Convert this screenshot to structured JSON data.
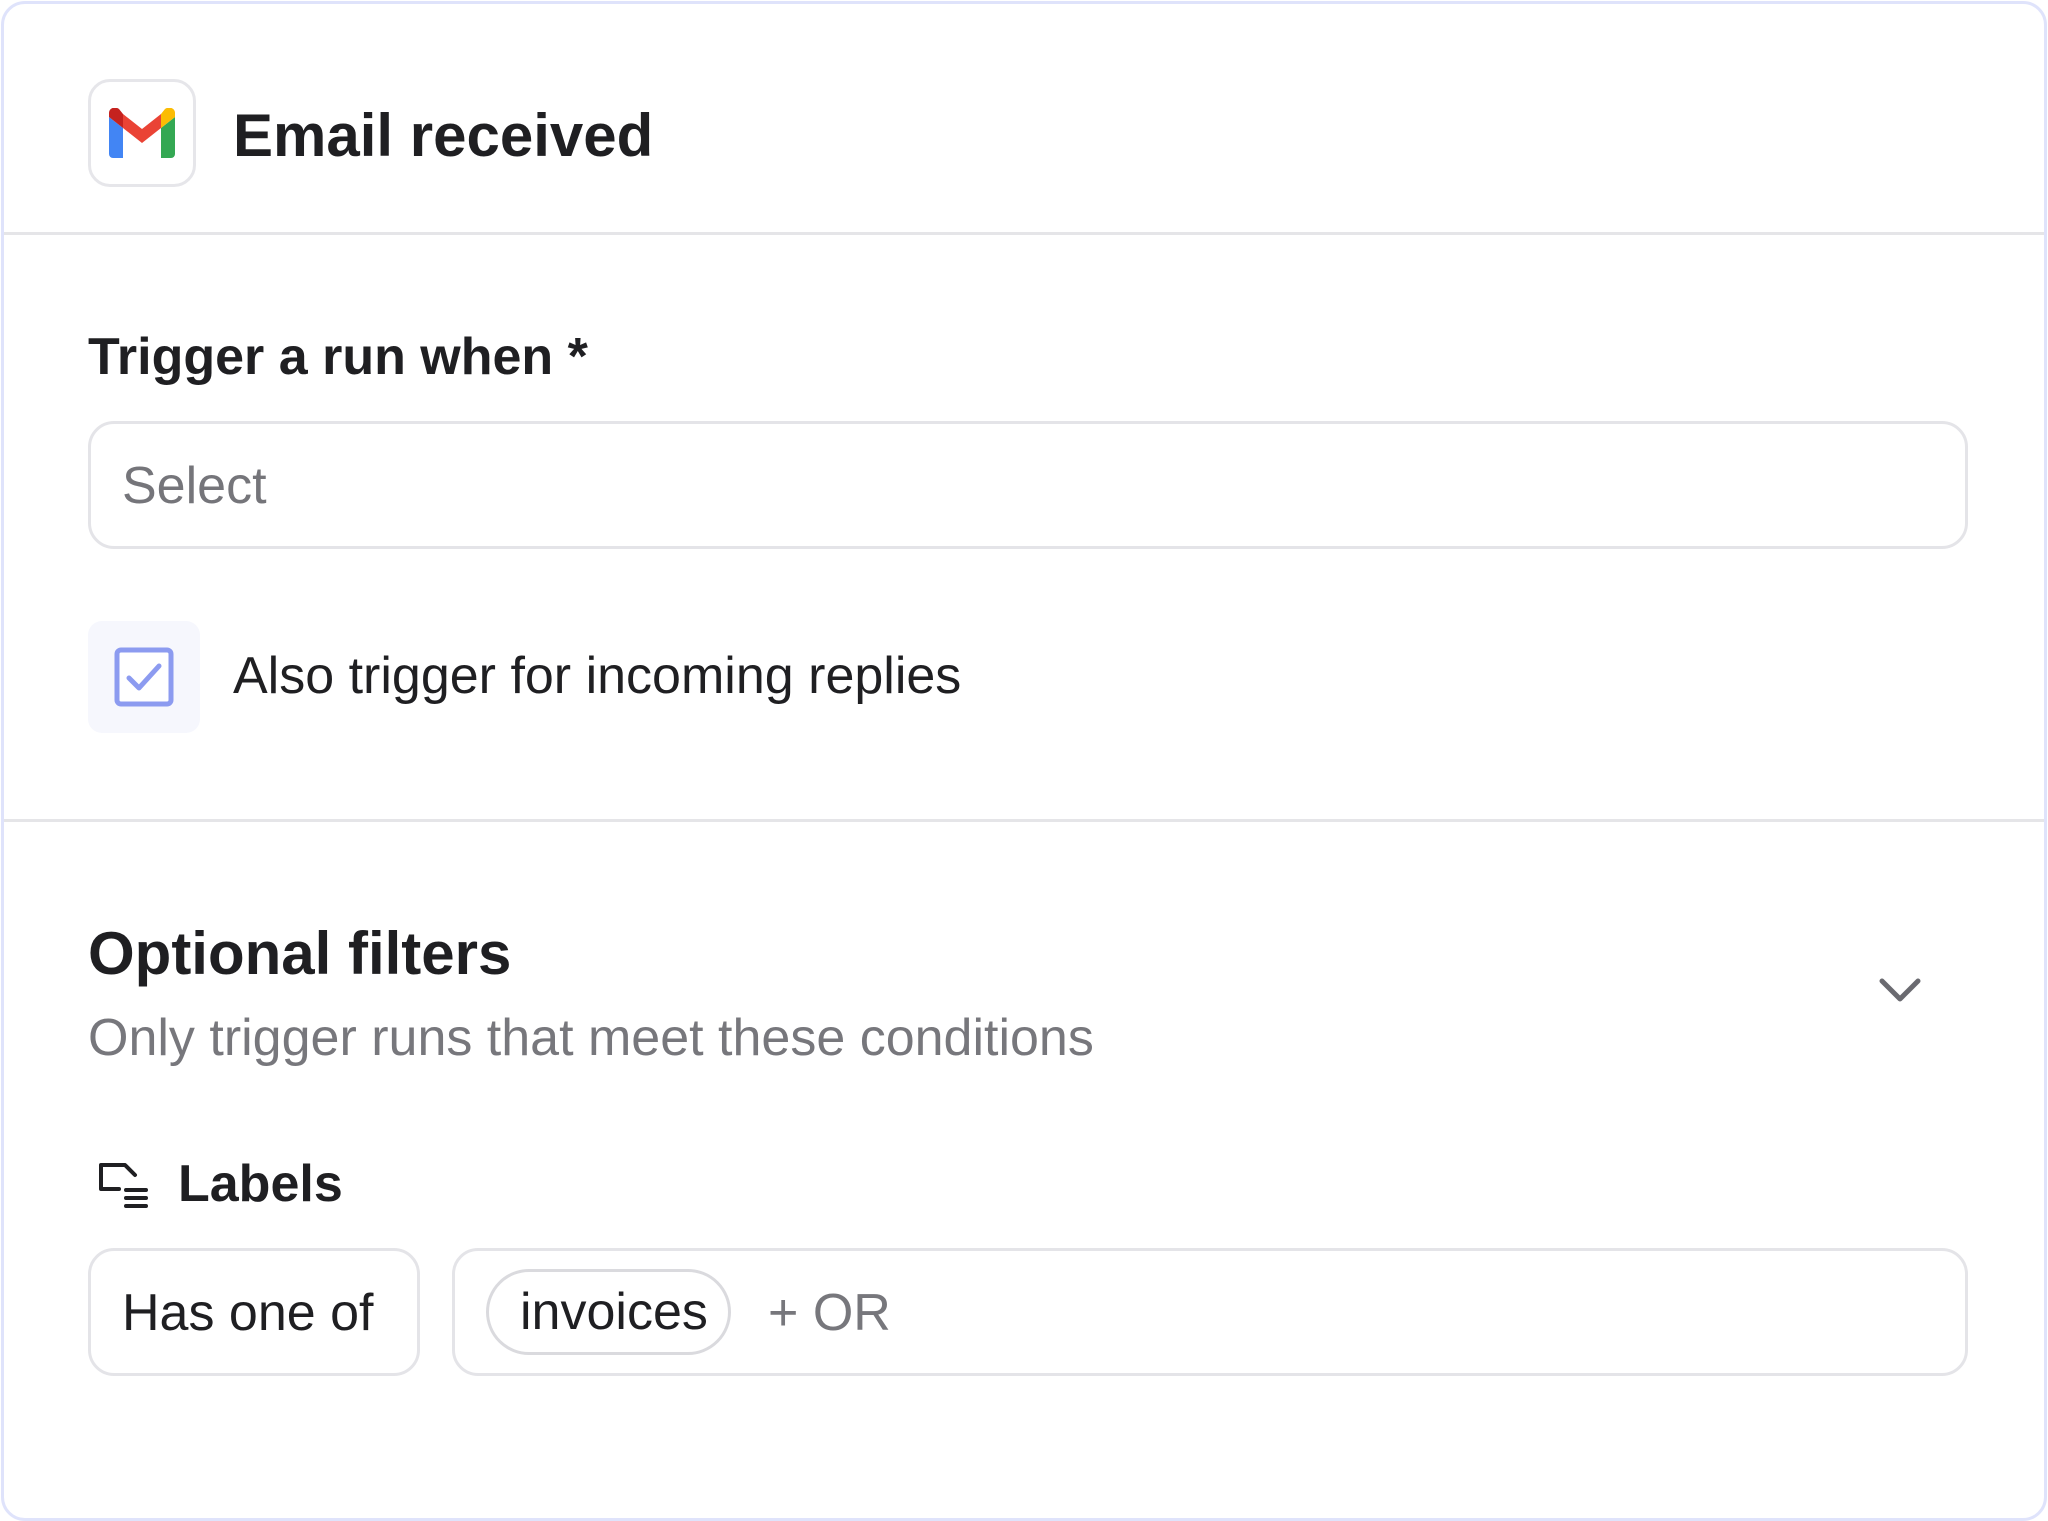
{
  "header": {
    "title": "Email received",
    "app_icon": "gmail-icon"
  },
  "trigger": {
    "label": "Trigger a run when *",
    "select_placeholder": "Select",
    "replies_checkbox": {
      "label": "Also trigger for incoming replies",
      "checked": true,
      "accent": "#8c9bf0"
    }
  },
  "filters": {
    "title": "Optional filters",
    "subtitle": "Only trigger runs that meet these conditions",
    "expand_icon": "chevron-down-icon",
    "labels": {
      "title": "Labels",
      "icon": "label-list-icon",
      "operator": "Has one of",
      "values": [
        "invoices"
      ],
      "add_or": "+ OR"
    }
  },
  "colors": {
    "card_border": "#dfe3fb",
    "divider": "#e5e5e8",
    "muted_text": "#77777c"
  }
}
